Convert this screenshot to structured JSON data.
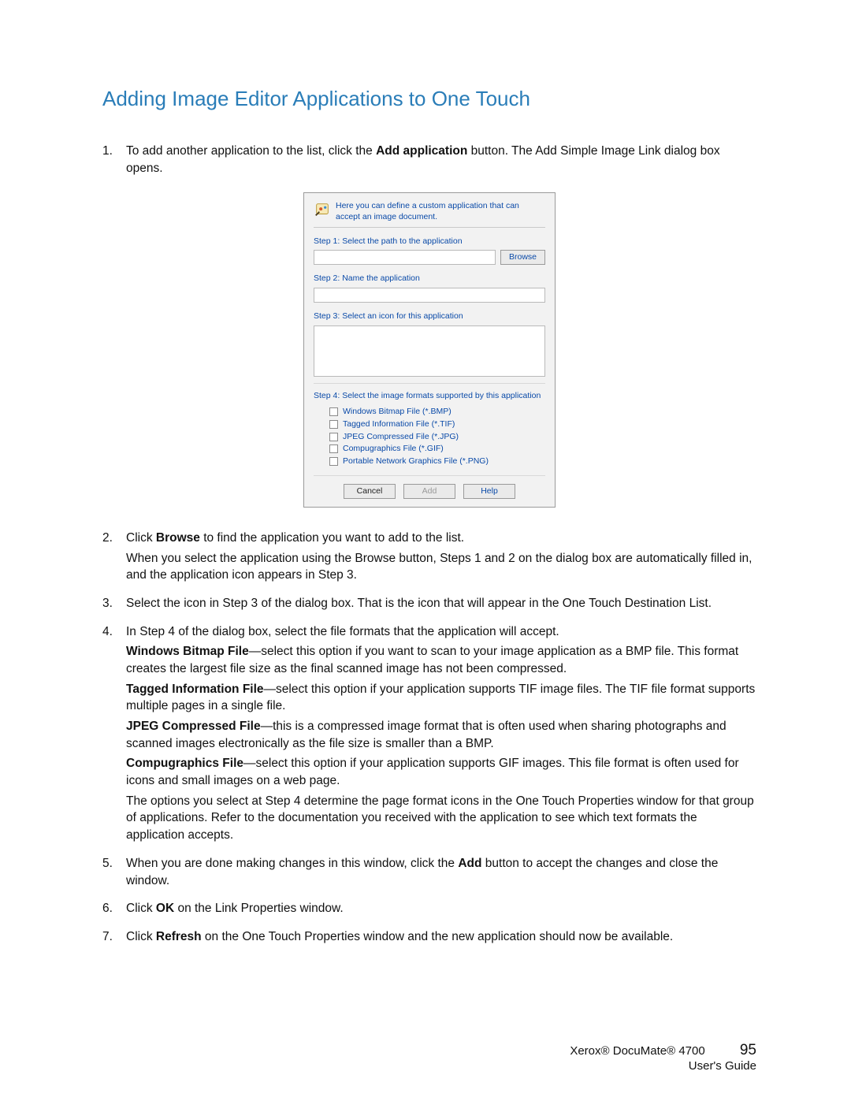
{
  "title": "Adding Image Editor Applications to One Touch",
  "steps": {
    "s1": {
      "num": "1.",
      "text_a": "To add another application to the list, click the ",
      "bold": "Add application",
      "text_b": " button. The Add Simple Image Link dialog box opens."
    },
    "s2": {
      "num": "2.",
      "text_a": "Click ",
      "bold": "Browse",
      "text_b": " to find the application you want to add to the list.",
      "sub": "When you select the application using the Browse button, Steps 1 and 2 on the dialog box are automatically filled in, and the application icon appears in Step 3."
    },
    "s3": {
      "num": "3.",
      "text": "Select the icon in Step 3 of the dialog box. That is the icon that will appear in the One Touch Destination List."
    },
    "s4": {
      "num": "4.",
      "text": "In Step 4 of the dialog box, select the file formats that the application will accept.",
      "p1b": "Windows Bitmap File",
      "p1t": "—select this option if you want to scan to your image application as a BMP file. This format creates the largest file size as the final scanned image has not been compressed.",
      "p2b": "Tagged Information File",
      "p2t": "—select this option if your application supports TIF image files. The TIF file format supports multiple pages in a single file.",
      "p3b": "JPEG Compressed File",
      "p3t": "—this is a compressed image format that is often used when sharing photographs and scanned images electronically as the file size is smaller than a BMP.",
      "p4b": "Compugraphics File",
      "p4t": "—select this option if your application supports GIF images. This file format is often used for icons and small images on a web page.",
      "p5": "The options you select at Step 4 determine the page format icons in the One Touch Properties window for that group of applications. Refer to the documentation you received with the application to see which text formats the application accepts."
    },
    "s5": {
      "num": "5.",
      "text_a": "When you are done making changes in this window, click the ",
      "bold": "Add",
      "text_b": " button to accept the changes and close the window."
    },
    "s6": {
      "num": "6.",
      "text_a": "Click ",
      "bold": "OK",
      "text_b": " on the Link Properties window."
    },
    "s7": {
      "num": "7.",
      "text_a": "Click ",
      "bold": "Refresh",
      "text_b": " on the One Touch Properties window and the new application should now be available."
    }
  },
  "dialog": {
    "header": "Here you can define a custom application that can accept an image document.",
    "step1": "Step 1: Select the path to the application",
    "browse": "Browse",
    "step2": "Step 2: Name the application",
    "step3": "Step 3: Select an icon for this application",
    "step4": "Step 4: Select the image formats supported by this application",
    "fmt1": "Windows Bitmap File (*.BMP)",
    "fmt2": "Tagged Information File (*.TIF)",
    "fmt3": "JPEG Compressed File (*.JPG)",
    "fmt4": "Compugraphics File (*.GIF)",
    "fmt5": "Portable Network Graphics File (*.PNG)",
    "cancel": "Cancel",
    "add": "Add",
    "help": "Help"
  },
  "footer": {
    "product": "Xerox® DocuMate® 4700",
    "guide": "User's Guide",
    "page": "95"
  }
}
